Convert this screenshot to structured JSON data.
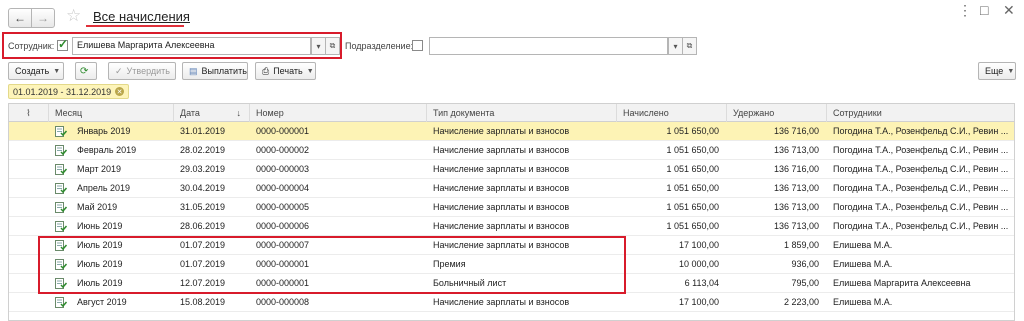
{
  "window": {
    "title": "Все начисления",
    "back_icon": "←",
    "forward_icon": "→",
    "star_icon": "☆",
    "controls": [
      "⋮",
      "□",
      "✕"
    ]
  },
  "filters": {
    "employee_label": "Сотрудник:",
    "employee_checked": true,
    "employee_value": "Елишева Маргарита Алексеевна",
    "department_label": "Подразделение:",
    "department_checked": false,
    "department_value": ""
  },
  "toolbar": {
    "create": "Создать",
    "approve": "Утвердить",
    "pay": "Выплатить",
    "print": "Печать",
    "more": "Еще"
  },
  "period_chip": "01.01.2019 - 31.12.2019",
  "table": {
    "columns": [
      "Месяц",
      "Дата",
      "Номер",
      "Тип документа",
      "Начислено",
      "Удержано",
      "Сотрудники"
    ],
    "sort_indicator": "↓",
    "rows": [
      {
        "month": "Январь 2019",
        "date": "31.01.2019",
        "number": "0000-000001",
        "type": "Начисление зарплаты и взносов",
        "accrued": "1 051 650,00",
        "withheld": "136 716,00",
        "employees": "Погодина Т.А., Розенфельд С.И., Ревин ..."
      },
      {
        "month": "Февраль 2019",
        "date": "28.02.2019",
        "number": "0000-000002",
        "type": "Начисление зарплаты и взносов",
        "accrued": "1 051 650,00",
        "withheld": "136 713,00",
        "employees": "Погодина Т.А., Розенфельд С.И., Ревин ..."
      },
      {
        "month": "Март 2019",
        "date": "29.03.2019",
        "number": "0000-000003",
        "type": "Начисление зарплаты и взносов",
        "accrued": "1 051 650,00",
        "withheld": "136 716,00",
        "employees": "Погодина Т.А., Розенфельд С.И., Ревин ..."
      },
      {
        "month": "Апрель 2019",
        "date": "30.04.2019",
        "number": "0000-000004",
        "type": "Начисление зарплаты и взносов",
        "accrued": "1 051 650,00",
        "withheld": "136 713,00",
        "employees": "Погодина Т.А., Розенфельд С.И., Ревин ..."
      },
      {
        "month": "Май 2019",
        "date": "31.05.2019",
        "number": "0000-000005",
        "type": "Начисление зарплаты и взносов",
        "accrued": "1 051 650,00",
        "withheld": "136 713,00",
        "employees": "Погодина Т.А., Розенфельд С.И., Ревин ..."
      },
      {
        "month": "Июнь 2019",
        "date": "28.06.2019",
        "number": "0000-000006",
        "type": "Начисление зарплаты и взносов",
        "accrued": "1 051 650,00",
        "withheld": "136 713,00",
        "employees": "Погодина Т.А., Розенфельд С.И., Ревин ..."
      },
      {
        "month": "Июль 2019",
        "date": "01.07.2019",
        "number": "0000-000007",
        "type": "Начисление зарплаты и взносов",
        "accrued": "17 100,00",
        "withheld": "1 859,00",
        "employees": "Елишева М.А."
      },
      {
        "month": "Июль 2019",
        "date": "01.07.2019",
        "number": "0000-000001",
        "type": "Премия",
        "accrued": "10 000,00",
        "withheld": "936,00",
        "employees": "Елишева М.А."
      },
      {
        "month": "Июль 2019",
        "date": "12.07.2019",
        "number": "0000-000001",
        "type": "Больничный лист",
        "accrued": "6 113,04",
        "withheld": "795,00",
        "employees": "Елишева Маргарита Алексеевна"
      },
      {
        "month": "Август 2019",
        "date": "15.08.2019",
        "number": "0000-000008",
        "type": "Начисление зарплаты и взносов",
        "accrued": "17 100,00",
        "withheld": "2 223,00",
        "employees": "Елишева М.А."
      }
    ]
  },
  "colors": {
    "highlight_red": "#d81b2b",
    "selected_row": "#fdf3b5",
    "check_green": "#2c8a2c"
  }
}
